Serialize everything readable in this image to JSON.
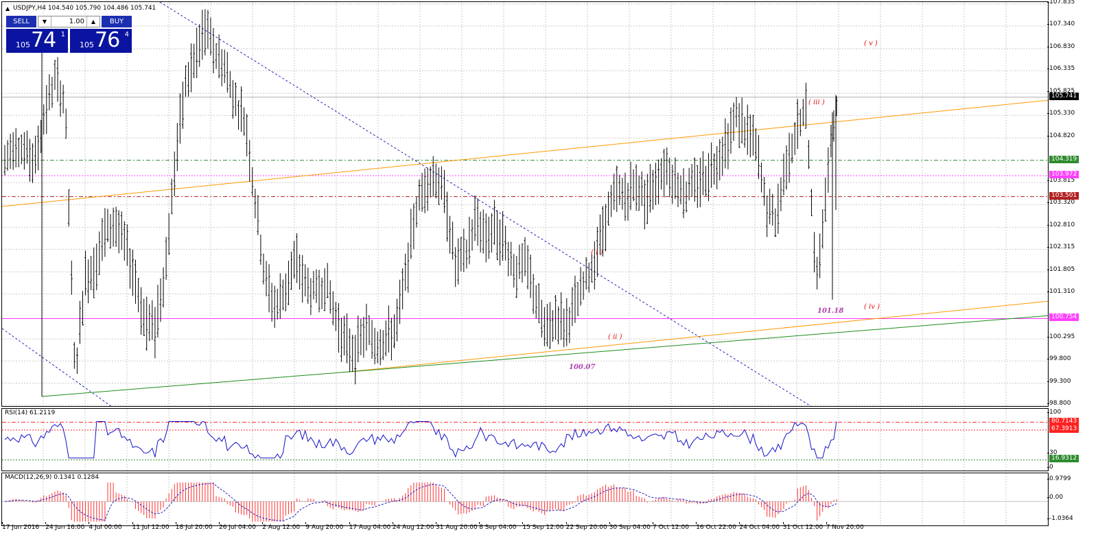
{
  "chart_header": {
    "symbol_line": "USDJPY,H4  104.540 105.790 104.486 105.741",
    "collapse_icon": "triangle-up-icon"
  },
  "trade_panel": {
    "sell_label": "SELL",
    "buy_label": "BUY",
    "lot_value": "1.00",
    "lot_decrement_icon": "triangle-down-icon",
    "lot_increment_icon": "triangle-up-icon",
    "sell_quote": {
      "prefix": "105",
      "big": "74",
      "sup": "1"
    },
    "buy_quote": {
      "prefix": "105",
      "big": "76",
      "sup": "4"
    }
  },
  "price_axis": {
    "ticks": [
      "107.835",
      "107.340",
      "106.830",
      "106.335",
      "105.825",
      "105.330",
      "104.820",
      "103.815",
      "103.320",
      "102.810",
      "102.315",
      "101.805",
      "101.310",
      "100.295",
      "99.800",
      "99.300",
      "98.800"
    ]
  },
  "price_tags": [
    {
      "value": "105.741",
      "color": "#000000"
    },
    {
      "value": "104.319",
      "color": "#2e8b2e"
    },
    {
      "value": "103.972",
      "color": "#ff40ff"
    },
    {
      "value": "103.501",
      "color": "#b22222"
    },
    {
      "value": "100.754",
      "color": "#ff40ff"
    }
  ],
  "wave_labels": {
    "v": "( v )",
    "iii": "( iii )",
    "i": "( i )",
    "ii": "( ii )",
    "iv": "( iv )"
  },
  "level_notes": {
    "low_1": "100.07",
    "low_2": "101.18"
  },
  "rsi": {
    "label": "RSI(14) 61.2119",
    "axis_ticks": [
      "100",
      "30",
      "0"
    ],
    "tags": [
      {
        "value": "80.7143",
        "color": "#ff2020"
      },
      {
        "value": "67.3913",
        "color": "#ff2020"
      },
      {
        "value": "16.9312",
        "color": "#2e8b2e"
      }
    ]
  },
  "macd": {
    "label": "MACD(12,26,9) 0.1341 0.1284",
    "axis_ticks": [
      "0.9799",
      "0.00",
      "-1.0364"
    ]
  },
  "time_axis": {
    "labels": [
      "17 Jun 2016",
      "24 Jun 16:00",
      "4 Jul 00:00",
      "11 Jul 12:00",
      "18 Jul 20:00",
      "26 Jul 04:00",
      "2 Aug 12:00",
      "9 Aug 20:00",
      "17 Aug 04:00",
      "24 Aug 12:00",
      "31 Aug 20:00",
      "8 Sep 04:00",
      "15 Sep 12:00",
      "22 Sep 20:00",
      "30 Sep 04:00",
      "7 Oct 12:00",
      "16 Oct 22:00",
      "24 Oct 04:00",
      "31 Oct 12:00",
      "7 Nov 20:00"
    ]
  },
  "chart_data": {
    "type": "candlestick",
    "symbol": "USDJPY",
    "timeframe": "H4",
    "ylim": [
      98.8,
      107.835
    ],
    "grid": true,
    "horizontal_levels": [
      104.319,
      103.972,
      103.501,
      100.754
    ],
    "price_anchors": [
      [
        104.2,
        104.4
      ],
      [
        104.6,
        104.9
      ],
      [
        104.3,
        104.7
      ],
      [
        104.0,
        104.5
      ],
      [
        105.2,
        105.6
      ],
      [
        106.0,
        106.3
      ],
      [
        105.5,
        105.8
      ],
      [
        99.3,
        99.6
      ],
      [
        101.4,
        101.9
      ],
      [
        101.7,
        102.2
      ],
      [
        102.4,
        102.9
      ],
      [
        102.7,
        103.1
      ],
      [
        102.2,
        102.6
      ],
      [
        101.4,
        101.9
      ],
      [
        100.4,
        100.9
      ],
      [
        100.3,
        100.8
      ],
      [
        101.6,
        102.1
      ],
      [
        104.0,
        104.5
      ],
      [
        105.8,
        106.2
      ],
      [
        106.4,
        106.8
      ],
      [
        107.0,
        107.5
      ],
      [
        106.6,
        106.9
      ],
      [
        106.2,
        106.6
      ],
      [
        105.5,
        105.8
      ],
      [
        105.0,
        105.4
      ],
      [
        103.2,
        103.6
      ],
      [
        101.4,
        101.8
      ],
      [
        100.8,
        101.2
      ],
      [
        101.2,
        101.6
      ],
      [
        101.9,
        102.3
      ],
      [
        101.3,
        101.7
      ],
      [
        101.1,
        101.5
      ],
      [
        101.4,
        101.8
      ],
      [
        100.6,
        101.0
      ],
      [
        100.0,
        100.4
      ],
      [
        99.8,
        100.2
      ],
      [
        100.3,
        100.7
      ],
      [
        100.0,
        100.4
      ],
      [
        100.1,
        100.5
      ],
      [
        100.3,
        100.7
      ],
      [
        101.5,
        101.9
      ],
      [
        103.0,
        103.4
      ],
      [
        103.6,
        104.0
      ],
      [
        103.8,
        104.2
      ],
      [
        103.2,
        103.6
      ],
      [
        101.7,
        102.1
      ],
      [
        102.0,
        102.4
      ],
      [
        102.8,
        103.2
      ],
      [
        102.4,
        102.8
      ],
      [
        102.6,
        103.0
      ],
      [
        102.2,
        102.6
      ],
      [
        101.6,
        102.0
      ],
      [
        101.8,
        102.2
      ],
      [
        101.0,
        101.4
      ],
      [
        100.2,
        100.6
      ],
      [
        100.6,
        101.0
      ],
      [
        100.4,
        100.8
      ],
      [
        100.9,
        101.3
      ],
      [
        101.4,
        101.8
      ],
      [
        102.0,
        102.4
      ],
      [
        102.8,
        103.2
      ],
      [
        103.4,
        103.8
      ],
      [
        103.3,
        103.7
      ],
      [
        103.6,
        104.0
      ],
      [
        103.2,
        103.6
      ],
      [
        103.7,
        104.1
      ],
      [
        104.0,
        104.4
      ],
      [
        103.6,
        104.0
      ],
      [
        103.4,
        103.8
      ],
      [
        103.6,
        104.0
      ],
      [
        103.8,
        104.2
      ],
      [
        104.1,
        104.5
      ],
      [
        104.5,
        104.9
      ],
      [
        105.1,
        105.5
      ],
      [
        104.8,
        105.2
      ],
      [
        104.4,
        104.8
      ],
      [
        103.0,
        103.4
      ],
      [
        102.8,
        103.2
      ],
      [
        104.1,
        104.5
      ],
      [
        104.8,
        105.2
      ],
      [
        105.3,
        105.6
      ],
      [
        101.3,
        101.7
      ],
      [
        103.5,
        103.9
      ],
      [
        105.6,
        105.8
      ]
    ],
    "resistance_lines": [
      "upper orange channel",
      "lower orange channel",
      "green support",
      "blue dashed downtrend"
    ],
    "rsi_levels": [
      80.7143,
      67.3913,
      16.9312
    ],
    "rsi_value": 61.2119,
    "macd_values": {
      "main": 0.1341,
      "signal": 0.1284
    },
    "macd_range": [
      -1.0364,
      0.9799
    ]
  },
  "colors": {
    "candle": "#000000",
    "grid": "#c8c8c8",
    "orange_line": "#ff9900",
    "green_line": "#1a8c1a",
    "blue_dash": "#2020c0",
    "magenta": "#ff33ff",
    "rsi_line": "#1010c8",
    "macd_hist": "#ff3030",
    "sell_buy": "#1b2fb0",
    "quote_bg": "#0a14a0"
  }
}
